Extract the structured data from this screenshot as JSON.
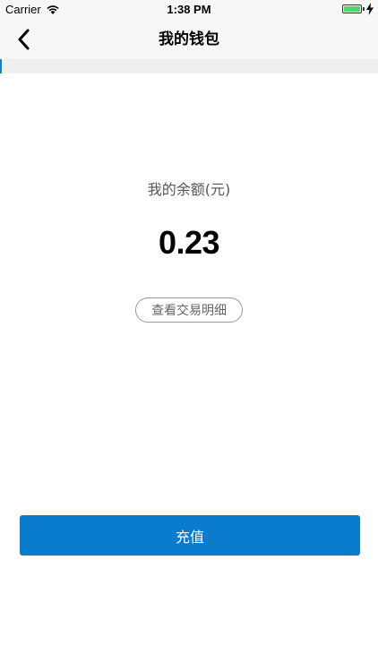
{
  "status_bar": {
    "carrier": "Carrier",
    "time": "1:38 PM",
    "battery_level": 1.0,
    "battery_color": "#4cd964"
  },
  "nav": {
    "title": "我的钱包",
    "back_icon": "chevron-left-icon"
  },
  "wallet": {
    "balance_label": "我的余额(元)",
    "balance_value": "0.23",
    "details_button": "查看交易明细",
    "recharge_button": "充值"
  },
  "colors": {
    "primary": "#0a7ccd",
    "nav_background": "#f7f7f7"
  }
}
